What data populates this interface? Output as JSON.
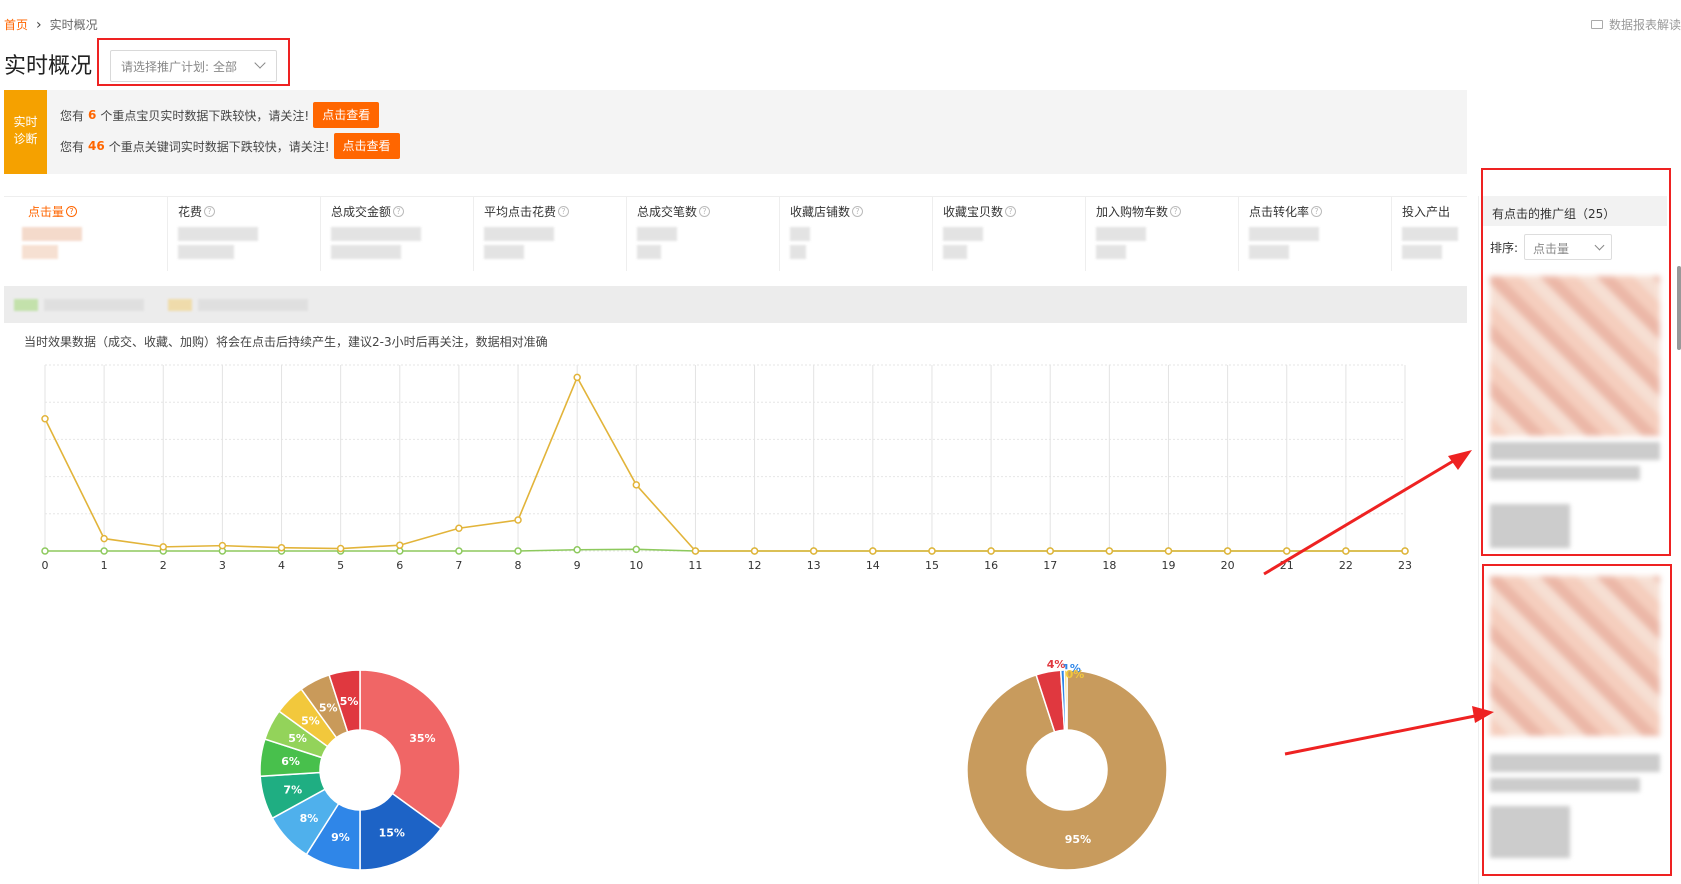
{
  "breadcrumb": {
    "home": "首页",
    "current": "实时概况"
  },
  "help_link": "数据报表解读",
  "page_title": "实时概况",
  "plan_select": {
    "label": "请选择推广计划:",
    "value": "全部"
  },
  "diagnosis": {
    "tag": [
      "实时",
      "诊断"
    ],
    "lines": [
      {
        "prefix": "您有",
        "count": "6",
        "suffix": "个重点宝贝实时数据下跌较快，请关注!",
        "button": "点击查看"
      },
      {
        "prefix": "您有",
        "count": "46",
        "suffix": "个重点关键词实时数据下跌较快，请关注!",
        "button": "点击查看"
      }
    ]
  },
  "metrics": [
    "点击量",
    "花费",
    "总成交金额",
    "平均点击花费",
    "总成交笔数",
    "收藏店铺数",
    "收藏宝贝数",
    "加入购物车数",
    "点击转化率",
    "投入产出"
  ],
  "chart_note": "当时效果数据（成交、收藏、加购）将会在点击后持续产生，建议2-3小时后再关注，数据相对准确",
  "colors": {
    "accent": "#ff6600",
    "tag_bg": "#f5a100",
    "highlight": "#ee2222",
    "line_today": "#e2b43a",
    "line_yesterday": "#8dc95d"
  },
  "sidebar": {
    "header": "有点击的推广组（25）",
    "sort_label": "排序:",
    "sort_value": "点击量"
  },
  "chart_data": [
    {
      "type": "line",
      "x": [
        "0",
        "1",
        "2",
        "3",
        "4",
        "5",
        "6",
        "7",
        "8",
        "9",
        "10",
        "11",
        "12",
        "13",
        "14",
        "15",
        "16",
        "17",
        "18",
        "19",
        "20",
        "21",
        "22",
        "23"
      ],
      "series": [
        {
          "values": [
            32,
            3,
            1,
            1.3,
            0.8,
            0.6,
            1.4,
            5.5,
            7.5,
            42,
            16,
            0,
            0,
            0,
            0,
            0,
            0,
            0,
            0,
            0,
            0,
            0,
            0,
            0
          ]
        },
        {
          "values": [
            0,
            0,
            0,
            0,
            0,
            0,
            0,
            0,
            0,
            0.3,
            0.4,
            0,
            0,
            0,
            0,
            0,
            0,
            0,
            0,
            0,
            0,
            0,
            0,
            0
          ]
        }
      ],
      "ylim": [
        0,
        45
      ]
    },
    {
      "type": "pie",
      "labels": [
        "35%",
        "15%",
        "9%",
        "8%",
        "7%",
        "6%",
        "5%",
        "5%",
        "5%",
        "5%"
      ],
      "values": [
        35,
        15,
        9,
        8,
        7,
        6,
        5,
        5,
        5,
        5
      ],
      "colors": [
        "#f06666",
        "#1d63c6",
        "#2f86e8",
        "#4fb0ec",
        "#1fae82",
        "#48c04c",
        "#93d35a",
        "#f2c83c",
        "#c99a5a",
        "#e0383f"
      ]
    },
    {
      "type": "pie",
      "labels": [
        "95%",
        "4%",
        "1%",
        "0%"
      ],
      "values": [
        95,
        4,
        0.6,
        0.4
      ],
      "colors": [
        "#c89b5d",
        "#e0383f",
        "#2f86e8",
        "#f2c83c"
      ]
    }
  ]
}
